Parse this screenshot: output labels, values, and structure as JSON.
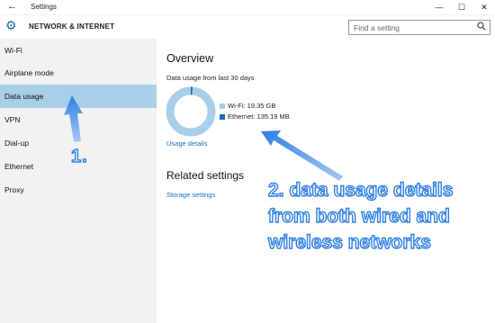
{
  "window": {
    "title": "Settings",
    "back_glyph": "←",
    "minimize_glyph": "—",
    "maximize_glyph": "☐",
    "close_glyph": "✕"
  },
  "header": {
    "icon": "gear-icon",
    "section_title": "NETWORK & INTERNET",
    "search_placeholder": "Find a setting"
  },
  "sidebar": {
    "items": [
      {
        "label": "Wi-Fi",
        "active": false
      },
      {
        "label": "Airplane mode",
        "active": false
      },
      {
        "label": "Data usage",
        "active": true
      },
      {
        "label": "VPN",
        "active": false
      },
      {
        "label": "Dial-up",
        "active": false
      },
      {
        "label": "Ethernet",
        "active": false
      },
      {
        "label": "Proxy",
        "active": false
      }
    ]
  },
  "main": {
    "overview_title": "Overview",
    "usage_caption": "Data usage from last 30 days",
    "legend": [
      {
        "label": "Wi-Fi: 19.35 GB",
        "color": "#a9cfe8",
        "value_gb": 19.35
      },
      {
        "label": "Ethernet: 135.19 MB",
        "color": "#1a6eb5",
        "value_gb": 0.13519
      }
    ],
    "usage_details_link": "Usage details",
    "related_title": "Related settings",
    "storage_link": "Storage settings"
  },
  "annotations": {
    "label_1": "1.",
    "label_2_lines": [
      "2. data usage details",
      "from both wired and",
      "wireless networks"
    ],
    "color": "#2f7fe6"
  },
  "colors": {
    "accent": "#1a6eb5",
    "selected_bg": "#a9cfe8",
    "sidebar_bg": "#f2f2f2"
  }
}
